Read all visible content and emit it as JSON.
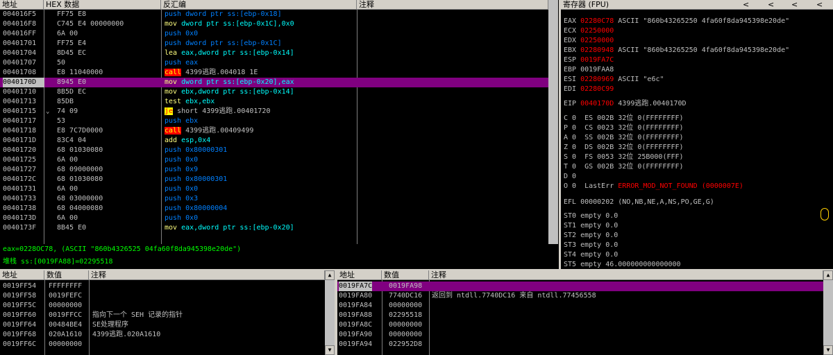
{
  "cpu": {
    "headers": {
      "addr": "地址",
      "hex": "HEX 数据",
      "asm": "反汇编",
      "comment": "注释"
    },
    "rows": [
      {
        "addr": "004016F5",
        "mark": "",
        "hex": "FF75 E8",
        "mn": "push",
        "kind": "push",
        "op": "dword ptr ss:[ebp-0x18]"
      },
      {
        "addr": "004016F8",
        "mark": "",
        "hex": "C745 E4 00000000",
        "mn": "mov",
        "kind": "norm",
        "op": "dword ptr ss:[ebp-0x1C],0x0"
      },
      {
        "addr": "004016FF",
        "mark": "",
        "hex": "6A 00",
        "mn": "push",
        "kind": "push",
        "op": "0x0"
      },
      {
        "addr": "00401701",
        "mark": "",
        "hex": "FF75 E4",
        "mn": "push",
        "kind": "push",
        "op": "dword ptr ss:[ebp-0x1C]"
      },
      {
        "addr": "00401704",
        "mark": "",
        "hex": "8D45 EC",
        "mn": "lea",
        "kind": "norm",
        "op": "eax,dword ptr ss:[ebp-0x14]"
      },
      {
        "addr": "00401707",
        "mark": "",
        "hex": "50",
        "mn": "push",
        "kind": "push",
        "op": "eax"
      },
      {
        "addr": "00401708",
        "mark": "",
        "hex": "E8 11040000",
        "mn": "call",
        "kind": "call",
        "op": "4399逃跑.004018 1E"
      },
      {
        "addr": "0040170D",
        "mark": "",
        "hex": "8945 E0",
        "mn": "mov",
        "kind": "norm",
        "op": "dword ptr ss:[ebp-0x20],eax",
        "sel": true
      },
      {
        "addr": "00401710",
        "mark": "",
        "hex": "8B5D EC",
        "mn": "mov",
        "kind": "norm",
        "op": "ebx,dword ptr ss:[ebp-0x14]"
      },
      {
        "addr": "00401713",
        "mark": "",
        "hex": "85DB",
        "mn": "test",
        "kind": "norm",
        "op": "ebx,ebx"
      },
      {
        "addr": "00401715",
        "mark": "⌄",
        "hex": "74 09",
        "mn": "je",
        "kind": "jmp",
        "op": "short 4399逃跑.00401720"
      },
      {
        "addr": "00401717",
        "mark": "",
        "hex": "53",
        "mn": "push",
        "kind": "push",
        "op": "ebx"
      },
      {
        "addr": "00401718",
        "mark": "",
        "hex": "E8 7C7D0000",
        "mn": "call",
        "kind": "call",
        "op": "4399逃跑.00409499"
      },
      {
        "addr": "0040171D",
        "mark": "",
        "hex": "83C4 04",
        "mn": "add",
        "kind": "norm",
        "op": "esp,0x4"
      },
      {
        "addr": "00401720",
        "mark": "",
        "hex": "68 01030080",
        "mn": "push",
        "kind": "push",
        "op": "0x80000301"
      },
      {
        "addr": "00401725",
        "mark": "",
        "hex": "6A 00",
        "mn": "push",
        "kind": "push",
        "op": "0x0"
      },
      {
        "addr": "00401727",
        "mark": "",
        "hex": "68 09000000",
        "mn": "push",
        "kind": "push",
        "op": "0x9"
      },
      {
        "addr": "0040172C",
        "mark": "",
        "hex": "68 01030080",
        "mn": "push",
        "kind": "push",
        "op": "0x80000301"
      },
      {
        "addr": "00401731",
        "mark": "",
        "hex": "6A 00",
        "mn": "push",
        "kind": "push",
        "op": "0x0"
      },
      {
        "addr": "00401733",
        "mark": "",
        "hex": "68 03000000",
        "mn": "push",
        "kind": "push",
        "op": "0x3"
      },
      {
        "addr": "00401738",
        "mark": "",
        "hex": "68 04000080",
        "mn": "push",
        "kind": "push",
        "op": "0x80000004"
      },
      {
        "addr": "0040173D",
        "mark": "",
        "hex": "6A 00",
        "mn": "push",
        "kind": "push",
        "op": "0x0"
      },
      {
        "addr": "0040173F",
        "mark": "",
        "hex": "8B45 E0",
        "mn": "mov",
        "kind": "norm",
        "op": "eax,dword ptr ss:[ebp-0x20]"
      }
    ]
  },
  "info": {
    "line1": "eax=0228OC78, (ASCII \"860b4326525 04fa60f8da945398e20de\")",
    "line2": "堆栈 ss:[0019FA88]=02295518"
  },
  "regs": {
    "title": "寄存器 (FPU)",
    "nav": [
      "<",
      "<",
      "<",
      "<"
    ],
    "lines": [
      {
        "name": "EAX",
        "val": "02280C78",
        "red": true,
        "rest": " ASCII \"860b43265250 4fa60f8da945398e20de\""
      },
      {
        "name": "ECX",
        "val": "02250000",
        "red": true,
        "rest": ""
      },
      {
        "name": "EDX",
        "val": "02250000",
        "red": true,
        "rest": ""
      },
      {
        "name": "EBX",
        "val": "02280948",
        "red": true,
        "rest": " ASCII \"860b43265250 4fa60f8da945398e20de\""
      },
      {
        "name": "ESP",
        "val": "0019FA7C",
        "red": true,
        "rest": ""
      },
      {
        "name": "EBP",
        "val": "0019FAA8",
        "red": false,
        "rest": ""
      },
      {
        "name": "ESI",
        "val": "02280969",
        "red": true,
        "rest": " ASCII \"e6c\""
      },
      {
        "name": "EDI",
        "val": "02280C99",
        "red": true,
        "rest": ""
      },
      {
        "name": "EIP",
        "val": "0040170D",
        "red": true,
        "rest": " 4399逃跑.0040170D"
      },
      {
        "name": "C 0",
        "val": "",
        "red": false,
        "rest": "  ES 002B 32位 0(FFFFFFFF)"
      },
      {
        "name": "P 0",
        "val": "",
        "red": false,
        "rest": "  CS 0023 32位 0(FFFFFFFF)"
      },
      {
        "name": "A 0",
        "val": "",
        "red": false,
        "rest": "  SS 002B 32位 0(FFFFFFFF)"
      },
      {
        "name": "Z 0",
        "val": "",
        "red": false,
        "rest": "  DS 002B 32位 0(FFFFFFFF)"
      },
      {
        "name": "S 0",
        "val": "",
        "red": false,
        "rest": "  FS 0053 32位 25B000(FFF)"
      },
      {
        "name": "T 0",
        "val": "",
        "red": false,
        "rest": "  GS 002B 32位 0(FFFFFFFF)"
      },
      {
        "name": "D 0",
        "val": "",
        "red": false,
        "rest": ""
      },
      {
        "name": "O 0",
        "val": "",
        "red": false,
        "rest": "  LastErr ",
        "err": "ERROR_MOD_NOT_FOUND (0000007E)"
      },
      {
        "name": "EFL",
        "val": "",
        "red": false,
        "rest": " 00000202 (NO,NB,NE,A,NS,PO,GE,G)"
      },
      {
        "name": "ST0",
        "val": "",
        "red": false,
        "rest": " empty 0.0"
      },
      {
        "name": "ST1",
        "val": "",
        "red": false,
        "rest": " empty 0.0"
      },
      {
        "name": "ST2",
        "val": "",
        "red": false,
        "rest": " empty 0.0"
      },
      {
        "name": "ST3",
        "val": "",
        "red": false,
        "rest": " empty 0.0"
      },
      {
        "name": "ST4",
        "val": "",
        "red": false,
        "rest": " empty 0.0"
      },
      {
        "name": "ST5",
        "val": "",
        "red": false,
        "rest": " empty 46.000000000000000"
      }
    ]
  },
  "dump": {
    "headers": {
      "addr": "地址",
      "val": "数值",
      "cmt": "注释"
    },
    "rows": [
      {
        "a": "0019FF54",
        "v": "FFFFFFFF",
        "c": ""
      },
      {
        "a": "0019FF58",
        "v": "0019FEFC",
        "c": ""
      },
      {
        "a": "0019FF5C",
        "v": "00000000",
        "c": ""
      },
      {
        "a": "0019FF60",
        "v": "0019FFCC",
        "c": "指向下一个 SEH 记录的指针"
      },
      {
        "a": "0019FF64",
        "v": "00484BE4",
        "c": "SE处理程序"
      },
      {
        "a": "0019FF68",
        "v": "020A1610",
        "c": "4399逃跑.020A1610"
      },
      {
        "a": "0019FF6C",
        "v": "00000000",
        "c": ""
      }
    ]
  },
  "stack": {
    "headers": {
      "addr": "地址",
      "val": "数值",
      "cmt": "注释"
    },
    "rows": [
      {
        "a": "0019FA7C",
        "v": "0019FA98",
        "c": "",
        "sel": true
      },
      {
        "a": "0019FA80",
        "v": "7740DC16",
        "c": "返回到 ntdll.7740DC16 来自 ntdll.77456558"
      },
      {
        "a": "0019FA84",
        "v": "00000000",
        "c": ""
      },
      {
        "a": "0019FA88",
        "v": "02295518",
        "c": ""
      },
      {
        "a": "0019FA8C",
        "v": "00000000",
        "c": ""
      },
      {
        "a": "0019FA90",
        "v": "00000000",
        "c": ""
      },
      {
        "a": "0019FA94",
        "v": "022952D8",
        "c": ""
      }
    ]
  }
}
